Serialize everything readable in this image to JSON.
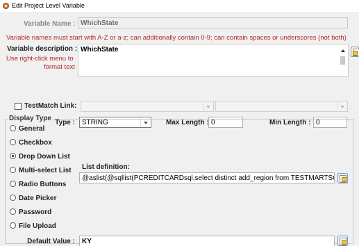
{
  "window": {
    "title": "Edit Project Level Variable",
    "app_icon": "app-icon"
  },
  "variable_name": {
    "label": "Variable Name :",
    "value": "WhichState"
  },
  "naming_rule": "Variable names must start with A-Z or a-z; can additionally contain 0-9; can contain spaces or underscores (not both)",
  "description": {
    "label": "Variable description :",
    "hint_line1": "Use right-click menu to",
    "hint_line2": "format text",
    "value": "WhichState"
  },
  "testmatch": {
    "label": "TestMatch Link:"
  },
  "type": {
    "label": "Type :",
    "value": "STRING"
  },
  "max_length": {
    "label": "Max Length :",
    "value": "0"
  },
  "min_length": {
    "label": "Min Length :",
    "value": "0"
  },
  "display_type": {
    "legend": "Display Type",
    "options": [
      "General",
      "Checkbox",
      "Drop Down List",
      "Multi-select List",
      "Radio Buttons",
      "Date Picker",
      "Password",
      "File Upload"
    ],
    "selected": "Drop Down List"
  },
  "list_definition": {
    "label": "List definition:",
    "value": "@aslist(@sqllist(PCREDITCARDsql,select distinct add_region from TESTMARTSQL)@)"
  },
  "default_value": {
    "label": "Default Value :",
    "value": "KY"
  },
  "colors": {
    "warning_text": "#b32626",
    "disabled_text": "#8a8a8a",
    "window_bg": "#f0f0f0"
  }
}
